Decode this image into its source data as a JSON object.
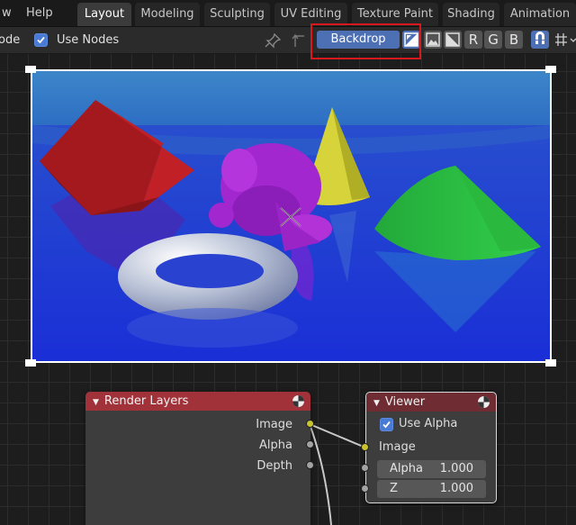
{
  "menu": {
    "partial_item": "w",
    "help": "Help"
  },
  "workspaces": [
    {
      "label": "Layout"
    },
    {
      "label": "Modeling"
    },
    {
      "label": "Sculpting"
    },
    {
      "label": "UV Editing"
    },
    {
      "label": "Texture Paint"
    },
    {
      "label": "Shading"
    },
    {
      "label": "Animation"
    }
  ],
  "header": {
    "mode_partial": "ode",
    "use_nodes_label": "Use Nodes",
    "use_nodes_checked": true,
    "backdrop_label": "Backdrop",
    "channels": [
      "R",
      "G",
      "B"
    ]
  },
  "nodes": {
    "render_layers": {
      "title": "Render Layers",
      "outputs": [
        "Image",
        "Alpha",
        "Depth"
      ]
    },
    "viewer": {
      "title": "Viewer",
      "use_alpha_label": "Use Alpha",
      "use_alpha_checked": true,
      "input_image": "Image",
      "alpha_label": "Alpha",
      "alpha_value": "1.000",
      "z_label": "Z",
      "z_value": "1.000"
    }
  },
  "colors": {
    "accent": "#4d6fb3",
    "highlight": "#d8181b",
    "node_header": "#a13239",
    "socket_image": "#c8c42f"
  }
}
